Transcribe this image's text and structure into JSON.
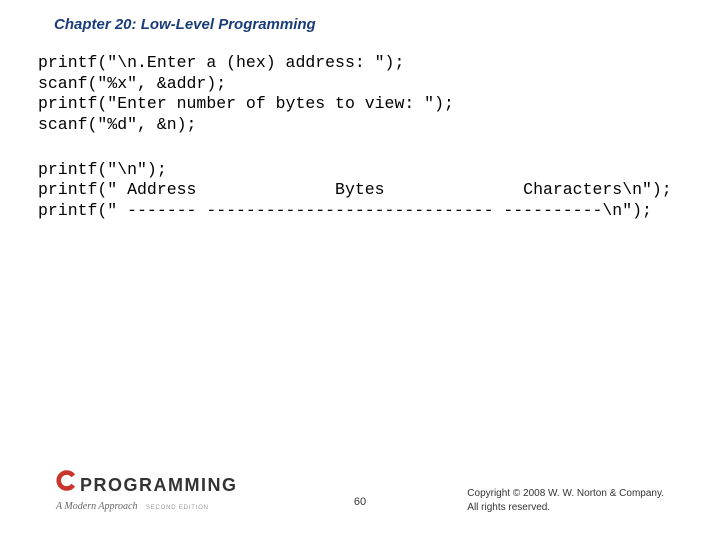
{
  "header": {
    "title": "Chapter 20: Low-Level Programming"
  },
  "code": {
    "block1_lines": [
      "printf(\"\\n.Enter a (hex) address: \");",
      "scanf(\"%x\", &addr);",
      "printf(\"Enter number of bytes to view: \");",
      "scanf(\"%d\", &n);"
    ],
    "block2_lines": [
      "printf(\"\\n\");",
      "printf(\" Address              Bytes              Characters\\n\");",
      "printf(\" ------- ----------------------------- ----------\\n\");"
    ]
  },
  "footer": {
    "logo_text": "PROGRAMMING",
    "logo_subtitle": "A Modern Approach",
    "logo_edition": "SECOND EDITION",
    "page_number": "60",
    "copyright_line1": "Copyright © 2008 W. W. Norton & Company.",
    "copyright_line2": "All rights reserved."
  }
}
